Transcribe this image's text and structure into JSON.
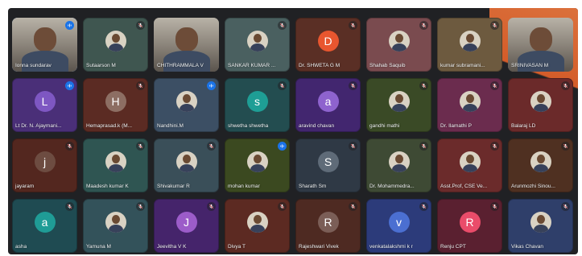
{
  "colors": {
    "muted_badge": "rgba(32,33,36,0.55)",
    "speaking_badge": "#1a73e8",
    "active_outline": "#7cb5ff"
  },
  "participants": [
    {
      "name": "Ionna sundarav",
      "kind": "video",
      "bg": "#8e877b",
      "status": "speaking",
      "active": true
    },
    {
      "name": "Sutaarson M",
      "kind": "photo",
      "bg": "#3f5650",
      "status": "muted"
    },
    {
      "name": "CHITHRAMMALA V",
      "kind": "video",
      "bg": "#8b8b80",
      "status": "none"
    },
    {
      "name": "SANKAR KUMAR ...",
      "kind": "photo",
      "bg": "#4a6060",
      "status": "muted"
    },
    {
      "name": "Dr. SHWETA G M",
      "kind": "initial",
      "initial": "D",
      "avatar": "#e8562f",
      "bg": "#5a2f25",
      "status": "muted"
    },
    {
      "name": "Shahab Saquib",
      "kind": "photo",
      "bg": "#7a4b4f",
      "status": "muted"
    },
    {
      "name": "kumar subramani...",
      "kind": "photo",
      "bg": "#6d5a3f",
      "status": "muted"
    },
    {
      "name": "SRINIVASAN M",
      "kind": "video",
      "bg": "#a9a396",
      "status": "none"
    },
    {
      "name": "Lt Dr. N. Ajaymani...",
      "kind": "initial",
      "initial": "L",
      "avatar": "#7e57c2",
      "bg": "#4a2f78",
      "status": "speaking"
    },
    {
      "name": "Hemaprasad.k (M...",
      "kind": "initial",
      "initial": "H",
      "avatar": "#8d6e63",
      "bg": "#5b2b23",
      "status": "muted"
    },
    {
      "name": "Nandhini.M",
      "kind": "photo",
      "bg": "#3c4f64",
      "status": "speaking"
    },
    {
      "name": "shwetha shwetha",
      "kind": "initial",
      "initial": "s",
      "avatar": "#1e9e95",
      "bg": "#234d50",
      "status": "muted"
    },
    {
      "name": "aravind chavan",
      "kind": "initial",
      "initial": "a",
      "avatar": "#8e63ce",
      "bg": "#42266f",
      "status": "muted"
    },
    {
      "name": "gandhi mathi",
      "kind": "photo",
      "bg": "#3a4a26",
      "status": "muted"
    },
    {
      "name": "Dr. Ilamathi P",
      "kind": "photo",
      "bg": "#6b2c4e",
      "status": "muted"
    },
    {
      "name": "Balaraj LD",
      "kind": "photo",
      "bg": "#6b2a2a",
      "status": "muted"
    },
    {
      "name": "jayaram",
      "kind": "initial",
      "initial": "j",
      "avatar": "#6d4c41",
      "bg": "#53271f",
      "status": "muted"
    },
    {
      "name": "Maadesh kumar K",
      "kind": "photo",
      "bg": "#2f5552",
      "status": "muted"
    },
    {
      "name": "Shivakumar R",
      "kind": "photo",
      "bg": "#3a4f59",
      "status": "muted"
    },
    {
      "name": "mohan kumar",
      "kind": "photo",
      "bg": "#3b4920",
      "status": "speaking"
    },
    {
      "name": "Sharath Sm",
      "kind": "initial",
      "initial": "S",
      "avatar": "#5f6b78",
      "bg": "#2f3945",
      "status": "muted"
    },
    {
      "name": "Dr. Mohammedra...",
      "kind": "photo",
      "bg": "#3e4a34",
      "status": "muted"
    },
    {
      "name": "Asst.Prof, CSE Ve...",
      "kind": "photo",
      "bg": "#6b2b2b",
      "status": "muted"
    },
    {
      "name": "Arunmozhi Sinou...",
      "kind": "photo",
      "bg": "#4f3021",
      "status": "muted"
    },
    {
      "name": "asha",
      "kind": "initial",
      "initial": "a",
      "avatar": "#1f9c96",
      "bg": "#1f4b52",
      "status": "muted"
    },
    {
      "name": "Yamuna M",
      "kind": "photo",
      "bg": "#33525a",
      "status": "muted"
    },
    {
      "name": "Jeevitha V K",
      "kind": "initial",
      "initial": "J",
      "avatar": "#9c5cc9",
      "bg": "#45246b",
      "status": "muted"
    },
    {
      "name": "Divya T",
      "kind": "photo",
      "bg": "#5c2a22",
      "status": "muted"
    },
    {
      "name": "Rajeshwari Vivek",
      "kind": "initial",
      "initial": "R",
      "avatar": "#7b5e57",
      "bg": "#4e2a22",
      "status": "muted"
    },
    {
      "name": "venkatalakshmi k r",
      "kind": "initial",
      "initial": "v",
      "avatar": "#4b6fd1",
      "bg": "#2c3b7a",
      "status": "muted"
    },
    {
      "name": "Renju CPT",
      "kind": "initial",
      "initial": "R",
      "avatar": "#ea4c6a",
      "bg": "#5a2030",
      "status": "muted"
    },
    {
      "name": "Vikas Chavan",
      "kind": "photo",
      "bg": "#2f3f6a",
      "status": "muted"
    }
  ]
}
